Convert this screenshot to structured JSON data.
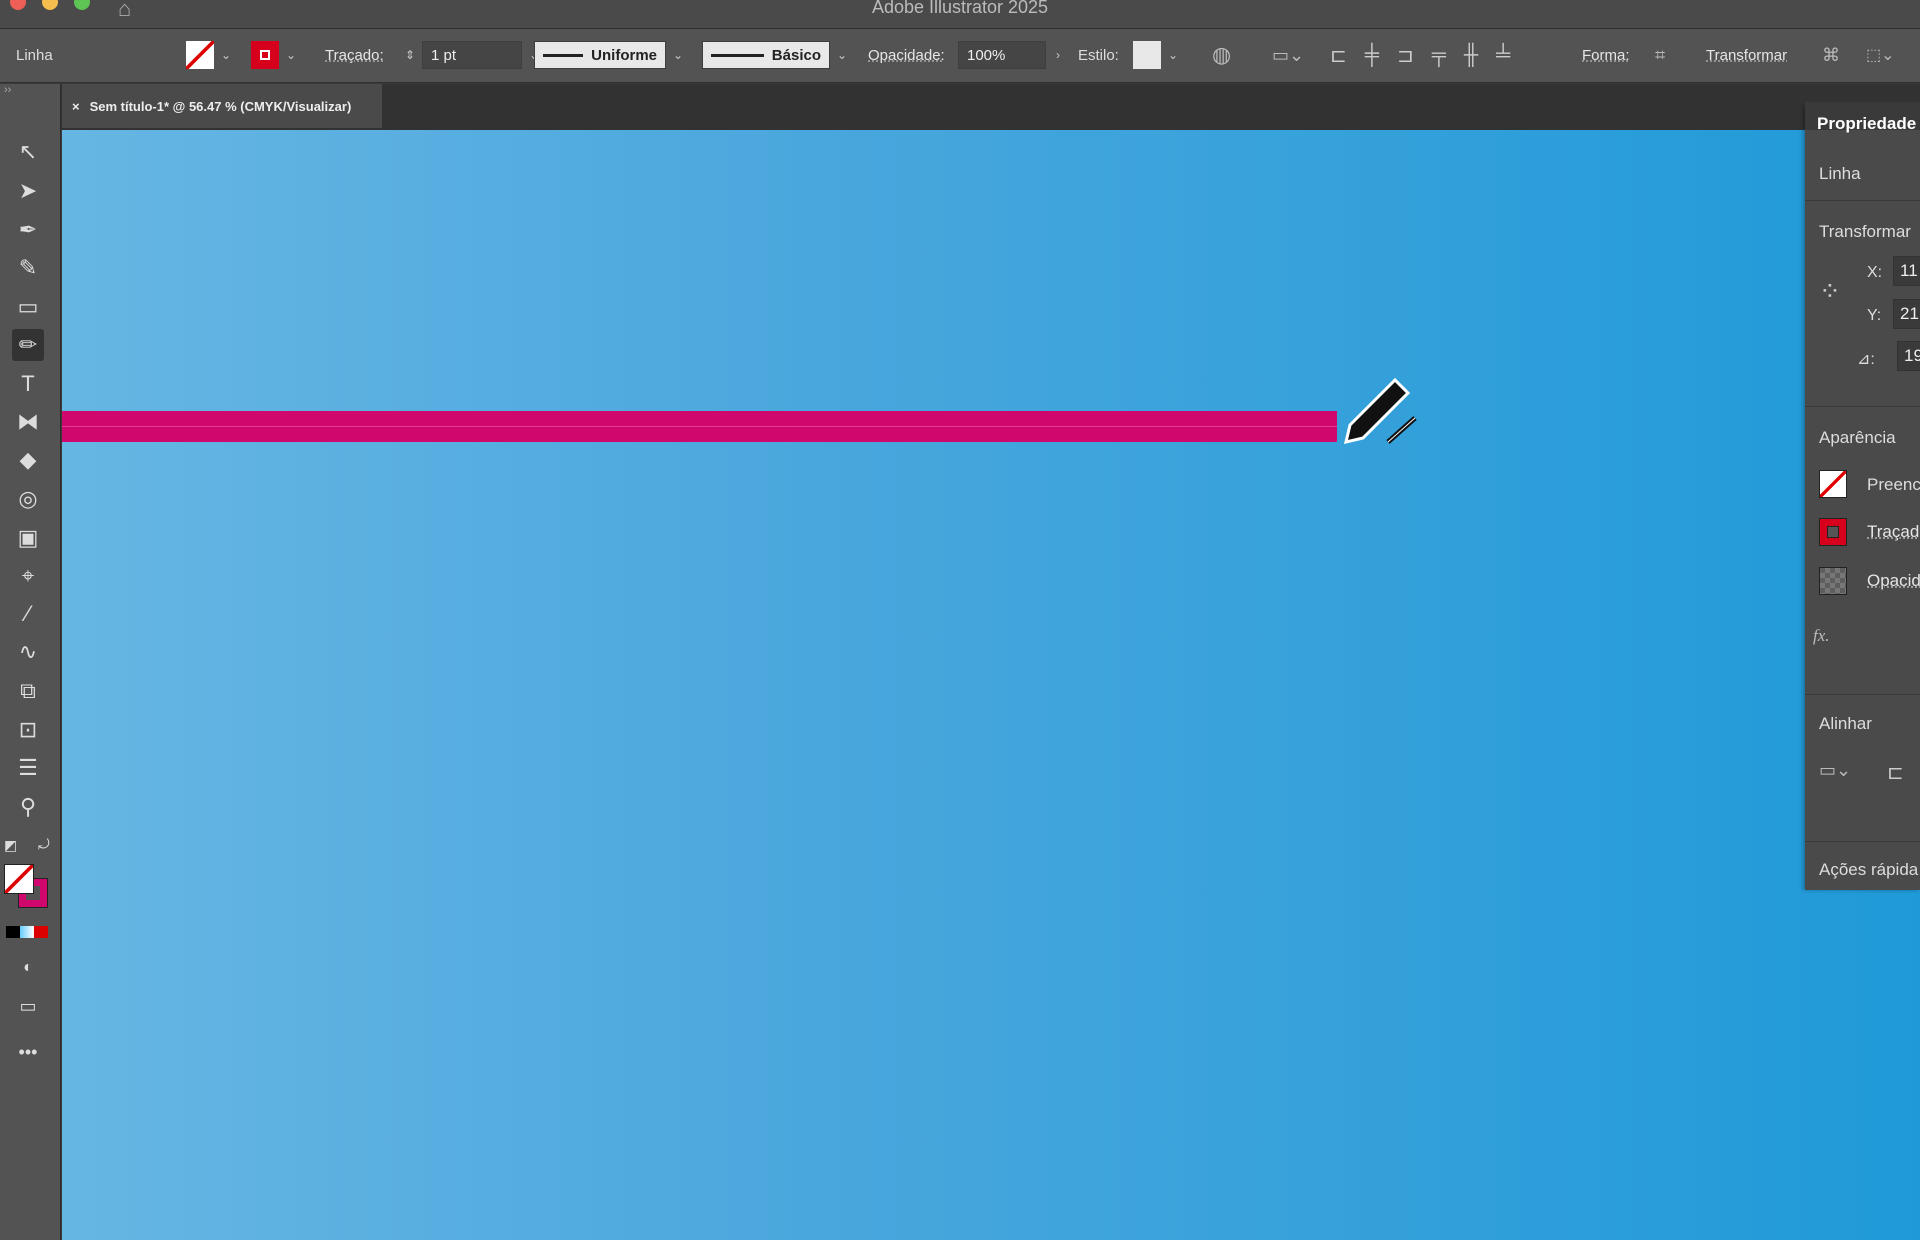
{
  "app_title": "Adobe Illustrator 2025",
  "control_bar": {
    "selection_type": "Linha",
    "stroke_label": "Traçado:",
    "stroke_weight": "1 pt",
    "profile": "Uniforme",
    "brush": "Básico",
    "opacity_label": "Opacidade:",
    "opacity": "100%",
    "style_label": "Estilo:",
    "shape_label": "Forma:",
    "transform_label": "Transformar"
  },
  "document_tab": {
    "close": "×",
    "title": "Sem título-1* @ 56.47 % (CMYK/Visualizar)"
  },
  "properties_panel": {
    "title": "Propriedade",
    "selection": "Linha",
    "transform_title": "Transformar",
    "x_label": "X:",
    "x_value": "11",
    "y_label": "Y:",
    "y_value": "21",
    "angle_label": "⊿:",
    "angle_value": "19",
    "appearance_title": "Aparência",
    "fill_label": "Preenc",
    "stroke_label": "Traçad",
    "opacity_label": "Opacid",
    "fx_label": "fx.",
    "align_title": "Alinhar",
    "quick_actions_title": "Ações rápida"
  },
  "colors": {
    "stroke_line": "#d0086e",
    "canvas_left": "#66b6e3",
    "canvas_right": "#1f9ad8"
  }
}
